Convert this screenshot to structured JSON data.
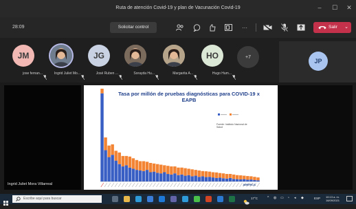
{
  "window": {
    "title": "Ruta de atención Covid-19 y plan de Vacunación Covid-19"
  },
  "toolbar": {
    "timer": "28:09",
    "request_control_label": "Solicitar control",
    "leave_label": "Salir",
    "leave_color": "#c4314b"
  },
  "participants": [
    {
      "name": "jose fernan...",
      "initials": "JM",
      "color": "#f2b9b4",
      "has_photo": false
    },
    {
      "name": "Ingrid Juliet Mo...",
      "initials": "",
      "color": "#6f7d8f",
      "has_photo": true,
      "active": true
    },
    {
      "name": "José Ruben ...",
      "initials": "JG",
      "color": "#c9d2e3",
      "has_photo": false
    },
    {
      "name": "Sorayda Hu...",
      "initials": "",
      "color": "#7b6b5d",
      "has_photo": true
    },
    {
      "name": "Margarita A...",
      "initials": "",
      "color": "#b6a48a",
      "has_photo": true
    },
    {
      "name": "Hugo Hum...",
      "initials": "HO",
      "color": "#dce8d6",
      "has_photo": false
    }
  ],
  "more_participants": "+7",
  "side_participant": {
    "initials": "JP",
    "color": "#a9c4ef"
  },
  "presenter": {
    "name": "Ingrid Juliet Mora Villarreal"
  },
  "slide": {
    "title_line1": "Tasa por millón de pruebas diagnósticas para COVID-19 x",
    "title_line2": "EAPB",
    "source_line1": "Fuente: Instituto Nacional de",
    "source_line2": "Salud",
    "logo_text": "AMERICA"
  },
  "chart_data": {
    "type": "bar",
    "stacked": true,
    "title": "Tasa por millón de pruebas diagnósticas para COVID-19 x EAPB",
    "series": [
      {
        "name": "",
        "color": "#3a5fc4",
        "values": [
          760,
          270,
          210,
          230,
          180,
          150,
          130,
          140,
          120,
          110,
          100,
          95,
          90,
          100,
          80,
          85,
          75,
          70,
          80,
          65,
          60,
          70,
          55,
          60,
          50,
          55,
          45,
          50,
          40,
          45,
          38,
          40,
          35,
          30,
          33,
          28,
          25,
          30,
          22,
          20,
          18,
          20,
          15,
          17,
          12,
          10
        ]
      },
      {
        "name": "",
        "color": "#f28434",
        "values": [
          40,
          110,
          100,
          90,
          85,
          100,
          90,
          80,
          95,
          90,
          85,
          80,
          85,
          70,
          80,
          70,
          75,
          75,
          60,
          70,
          70,
          60,
          65,
          60,
          65,
          55,
          60,
          50,
          55,
          45,
          50,
          45,
          45,
          48,
          40,
          42,
          40,
          35,
          38,
          35,
          35,
          30,
          32,
          28,
          28,
          25
        ]
      }
    ],
    "grid": false,
    "legend": "top-right"
  },
  "taskbar": {
    "search_placeholder": "Escribe aquí para buscar",
    "temperature": "17°C",
    "language": "ESP",
    "time": "10:13 a. m.",
    "date": "16/09/2021"
  }
}
